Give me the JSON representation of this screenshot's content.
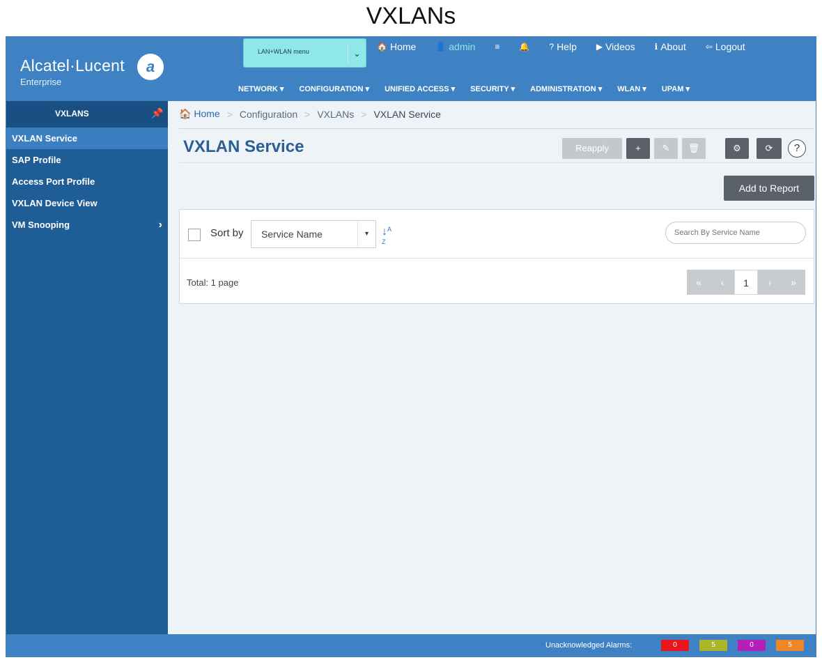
{
  "caption": "VXLANs",
  "header": {
    "brand": "Alcatel·Lucent",
    "brand_sub": "Enterprise",
    "logo_mark": "a",
    "menu_select": "LAN+WLAN menu",
    "links": [
      {
        "icon": "home-icon",
        "glyph": "🏠",
        "label": "Home"
      },
      {
        "icon": "user-icon",
        "glyph": "👤",
        "label": "admin"
      },
      {
        "icon": "list-icon",
        "glyph": "≡",
        "label": ""
      },
      {
        "icon": "bell-icon",
        "glyph": "🔔",
        "label": ""
      },
      {
        "icon": "help-icon",
        "glyph": "?",
        "label": "Help"
      },
      {
        "icon": "video-icon",
        "glyph": "▶",
        "label": "Videos"
      },
      {
        "icon": "info-icon",
        "glyph": "ℹ",
        "label": "About"
      },
      {
        "icon": "logout-icon",
        "glyph": "⇦",
        "label": "Logout"
      }
    ],
    "nav": [
      "NETWORK ▾",
      "CONFIGURATION ▾",
      "UNIFIED ACCESS ▾",
      "SECURITY ▾",
      "ADMINISTRATION ▾",
      "WLAN ▾",
      "UPAM ▾"
    ]
  },
  "sidebar": {
    "title": "VXLANS",
    "items": [
      {
        "label": "VXLAN Service",
        "active": true
      },
      {
        "label": "SAP Profile"
      },
      {
        "label": "Access Port Profile"
      },
      {
        "label": "VXLAN Device View"
      },
      {
        "label": "VM Snooping",
        "has_children": true
      }
    ]
  },
  "breadcrumb": [
    "Home",
    "Configuration",
    "VXLANs",
    "VXLAN Service"
  ],
  "page_title": "VXLAN Service",
  "toolbar": {
    "reapply": "Reapply",
    "add": "+",
    "edit": "✎",
    "delete": "🗑",
    "settings": "⚙",
    "refresh": "⟳",
    "help": "?"
  },
  "add_to_report": "Add to Report",
  "list": {
    "sort_label": "Sort by",
    "sort_value": "Service Name",
    "sort_caret": "▾",
    "sort_glyph": "↓",
    "search_placeholder": "Search By Service Name",
    "total": "Total: 1 page",
    "pager": {
      "first": "«",
      "prev": "‹",
      "page": "1",
      "next": "›",
      "last": "»"
    }
  },
  "footer": {
    "alarm_label": "Unacknowledged Alarms:",
    "alarms": [
      {
        "value": "0",
        "color": "#e8161c"
      },
      {
        "value": "5",
        "color": "#a9b52a"
      },
      {
        "value": "0",
        "color": "#b51eb9"
      },
      {
        "value": "5",
        "color": "#f0862a"
      }
    ]
  }
}
